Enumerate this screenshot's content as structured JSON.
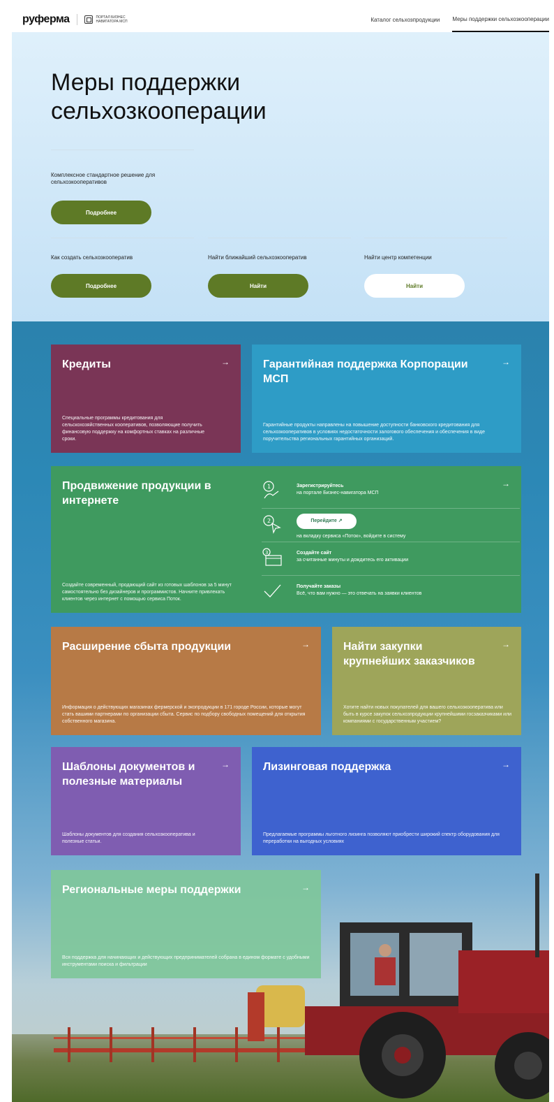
{
  "header": {
    "logo": "руферма",
    "portal_line1": "ПОРТАЛ БИЗНЕС",
    "portal_line2": "НАВИГАТОРА МСП",
    "nav": [
      "Каталог сельхозпродукции",
      "Меры поддержки сельхозкооперации"
    ]
  },
  "hero": {
    "title_line1": "Меры поддержки",
    "title_line2": "сельхозкооперации",
    "description": "Комплексное стандартное решение для сельхозкооперативов",
    "more_button": "Подробнее",
    "items": [
      {
        "label": "Как создать сельхозкооператив",
        "button": "Подробнее"
      },
      {
        "label": "Найти ближайший сельхозкооператив",
        "button": "Найти"
      },
      {
        "label": "Найти центр компетенции",
        "button": "Найти"
      }
    ]
  },
  "cards": {
    "credits": {
      "title": "Кредиты",
      "text": "Специальные программы кредитования для сельскохозяйственных кооперативов, позволяющие получить финансовую поддержку на комфортных ставках на различные сроки."
    },
    "guarantee": {
      "title": "Гарантийная поддержка Корпорации МСП",
      "text": "Гарантийные продукты направлены на повышение доступности банковского кредитования для сельхозкооперативов в условиях недостаточности залогового обеспечения и обеспечения в виде поручительства региональных гарантийных организаций."
    },
    "promotion": {
      "title": "Продвижение продукции в интернете",
      "text": "Создайте современный, продающий сайт из готовых шаблонов за 5 минут самостоятельно без дизайнеров и программистов. Начните привлекать клиентов через интернет с помощью сервиса Поток.",
      "steps": [
        {
          "title": "Зарегистрируйтесь",
          "sub": "на портале Бизнес-навигатора МСП"
        },
        {
          "button": "Перейдите ↗",
          "sub": "на вкладку сервиса «Поток», войдите в систему"
        },
        {
          "title": "Создайте сайт",
          "sub": "за считанные минуты и дождитесь его активации"
        },
        {
          "title": "Получайте заказы",
          "sub": "Всё, что вам нужно — это отвечать на заявки клиентов"
        }
      ]
    },
    "sales": {
      "title": "Расширение сбыта продукции",
      "text": "Информация о действующих магазинах фермерской и экопродукции в 171 городе России, которые могут стать вашими партнерами по организации сбыта. Сервис по подбору свободных помещений для открытия собственного магазина."
    },
    "purchases": {
      "title": "Найти закупки крупнейших заказчиков",
      "text": "Хотите найти новых покупателей для вашего сельхозкооператива или быть в курсе закупок сельхозпродукции крупнейшими госзаказчиками или компаниями с государственным участием?"
    },
    "templates": {
      "title": "Шаблоны документов и полезные материалы",
      "text": "Шаблоны документов для создания сельхозкооператива и полезные статьи."
    },
    "leasing": {
      "title": "Лизинговая поддержка",
      "text": "Предлагаемые программы льготного лизинга позволяют приобрести широкий спектр оборудования для переработки на выгодных условиях"
    },
    "regional": {
      "title": "Региональные меры поддержки",
      "text": "Вся поддержка для начинающих и действующих предпринимателей собрана в едином формате с удобными инструментами поиска и фильтрации"
    }
  },
  "arrow": "→",
  "colors": {
    "accent_green": "#5e7a26",
    "credits": "#7a3556",
    "guarantee": "#2e9cc6",
    "promotion": "#3f9a5f",
    "sales": "#b77a46",
    "purchases": "#9ea55a",
    "templates": "#7f5db1",
    "leasing": "#3e62cf",
    "regional": "#7fc79a"
  }
}
